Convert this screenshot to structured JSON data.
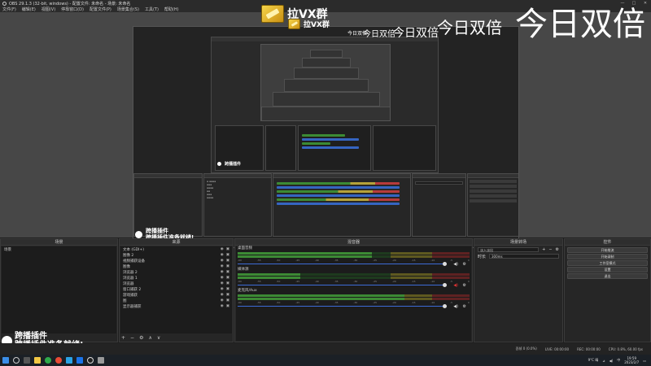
{
  "window": {
    "title": "OBS 29.1.3 (32-bit, windows) - 配置文件: 未命名 - 场景: 未命名",
    "controls": [
      "—",
      "□",
      "✕"
    ]
  },
  "menu": [
    "文件(F)",
    "编辑(E)",
    "视图(V)",
    "停靠窗口(D)",
    "配置文件(P)",
    "场景集合(S)",
    "工具(T)",
    "帮助(H)"
  ],
  "ads": {
    "big_label": "拉VX群",
    "small_label": "拉VX群",
    "double_texts": [
      "今日双倍",
      "今日双倍",
      "今日双倍",
      "今日双倍",
      "今日双倍"
    ]
  },
  "overlay": {
    "line1": "跨播插件",
    "line2": "跨播插件准备就绪!"
  },
  "docks": {
    "scenes": {
      "title": "场景",
      "items": [
        "场景"
      ]
    },
    "sources": {
      "title": "来源",
      "items": [
        "文本 (GDI+)",
        "图像 2",
        "视频捕获设备",
        "图像",
        "浏览器 2",
        "浏览器 1",
        "浏览器",
        "窗口捕获 2",
        "游戏捕获",
        "图",
        "显示器捕获"
      ],
      "tools": [
        "+",
        "−",
        "⚙",
        "∧",
        "∨"
      ]
    },
    "mixer": {
      "title": "混音器",
      "channels": [
        {
          "name": "桌面音频",
          "level": 0.58
        },
        {
          "name": "媒体源",
          "level": 0.27
        },
        {
          "name": "麦克风/Aux",
          "level": 0.72
        }
      ],
      "ticks": [
        "-60",
        "-55",
        "-50",
        "-45",
        "-40",
        "-35",
        "-30",
        "-25",
        "-20",
        "-15",
        "-10",
        "-5",
        "0"
      ]
    },
    "transitions": {
      "title": "场景转场",
      "type": "淡入淡出",
      "duration_label": "时长",
      "duration": "300ms"
    },
    "controls": {
      "title": "控件",
      "buttons": [
        "开始推流",
        "开始录制",
        "工作室模式",
        "设置",
        "退出"
      ]
    }
  },
  "status": {
    "cpu": "CPU: 0.8%, 60.00 fps",
    "live": "LIVE: 00:00:00",
    "rec": "REC: 00:00:00",
    "frames": "丢帧 0 (0.0%)"
  },
  "taskbar": {
    "weather": "9°C 晴",
    "time": "19:59",
    "date": "2023/2/7",
    "lang": "中"
  },
  "colors": {
    "meter_green": "#3c8a34",
    "meter_yellow": "#b5a23a",
    "meter_red": "#b73b3b",
    "slider_blue": "#3d6bd6"
  }
}
